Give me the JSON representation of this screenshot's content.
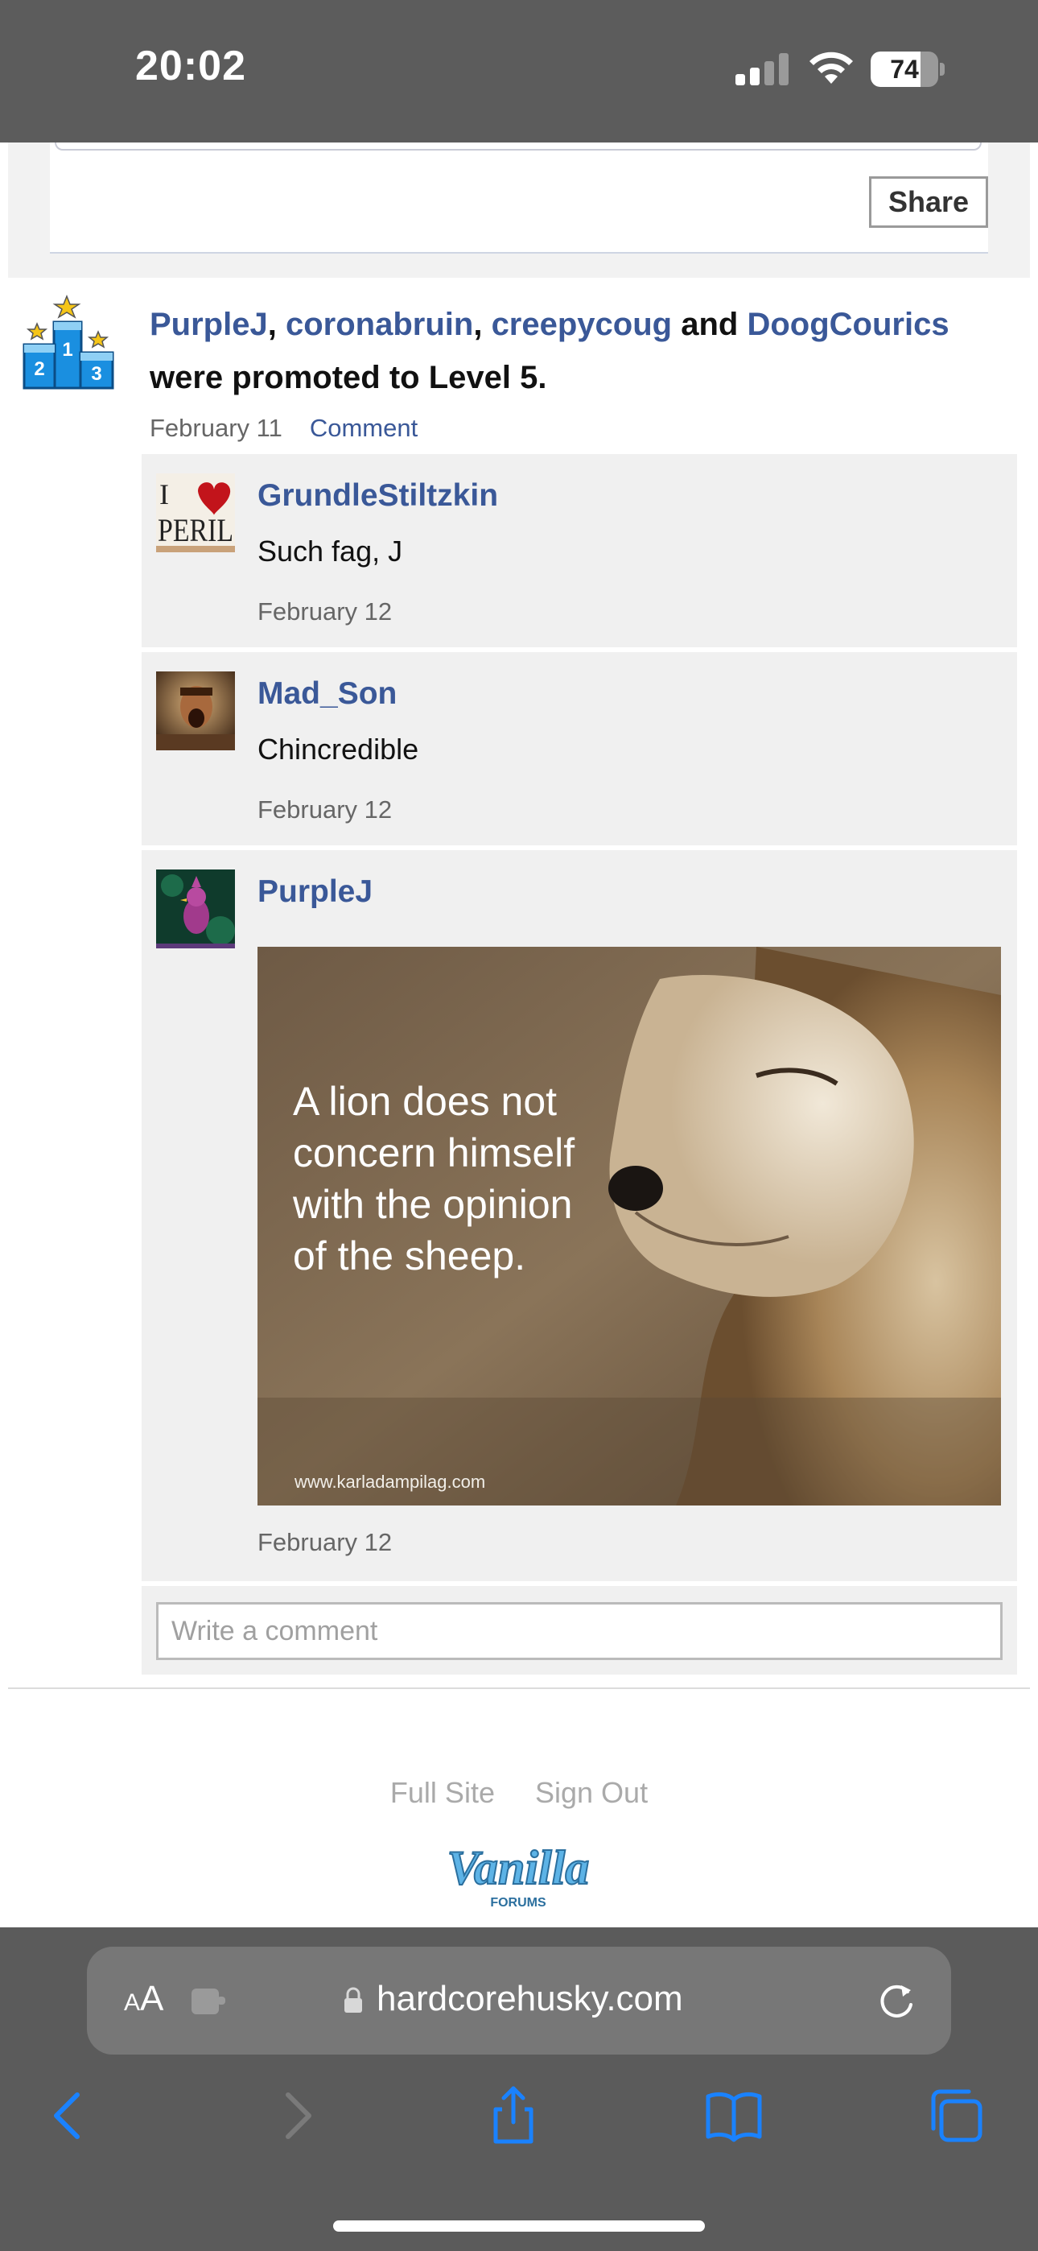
{
  "status_bar": {
    "time": "20:02",
    "battery_percent": "74",
    "battery_level": 0.74,
    "signal_bars_active": 2,
    "signal_bars_total": 4
  },
  "share": {
    "button_label": "Share"
  },
  "activity": {
    "users": [
      "PurpleJ",
      "coronabruin",
      "creepycoug",
      "DoogCourics"
    ],
    "separator_comma": ",",
    "and_text": "and",
    "promotion_text": "were promoted to Level 5.",
    "date": "February 11",
    "comment_link": "Comment",
    "icon": "podium-icon",
    "podium_numbers": [
      "2",
      "1",
      "3"
    ]
  },
  "comments": [
    {
      "author": "GrundleStiltzkin",
      "body": "Such fag, J",
      "date": "February 12",
      "avatar": "i-heart-peril-avatar",
      "avatar_text": {
        "top": "I",
        "bottom": "PERIL"
      }
    },
    {
      "author": "Mad_Son",
      "body": "Chincredible",
      "date": "February 12",
      "avatar": "warrior-avatar"
    },
    {
      "author": "PurpleJ",
      "body": "",
      "date": "February 12",
      "avatar": "bird-avatar",
      "image": {
        "quote_lines": [
          "A lion does not",
          "concern himself",
          "with the opinion",
          "of the sheep."
        ],
        "watermark": "www.karladampilag.com"
      }
    }
  ],
  "comment_box": {
    "placeholder": "Write a comment"
  },
  "footer": {
    "full_site": "Full Site",
    "sign_out": "Sign Out",
    "logo": "Vanilla",
    "logo_sub": "FORUMS"
  },
  "browser": {
    "aa_small": "A",
    "aa_large": "A",
    "url": "hardcorehusky.com"
  },
  "colors": {
    "link_blue": "#3a5898",
    "status_bar_bg": "#5c5c5c",
    "browser_bg": "#5b5b5b",
    "ios_blue": "#1a82ff"
  }
}
